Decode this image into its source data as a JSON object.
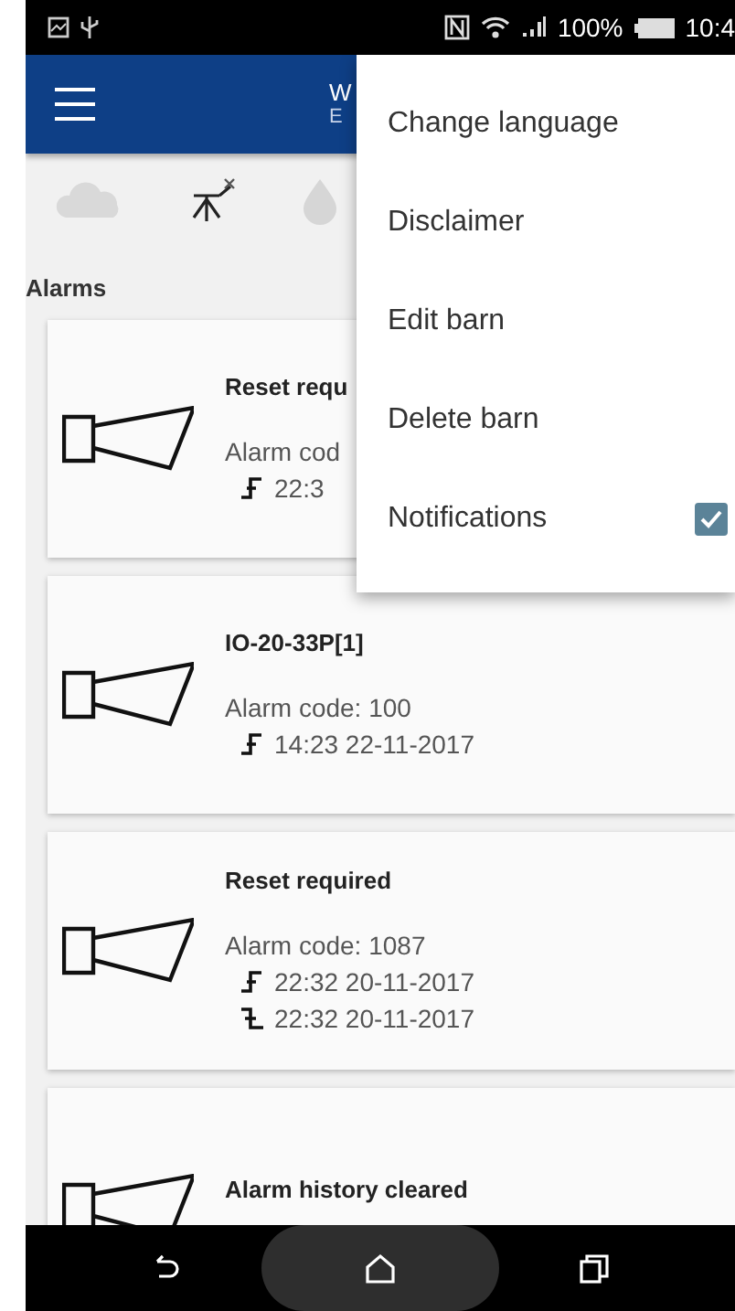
{
  "status_bar": {
    "battery": "100%",
    "time": "10:4"
  },
  "app_bar": {
    "title": "W",
    "subtitle": "E"
  },
  "section_title": "Alarms",
  "alarms": [
    {
      "title": "Reset requ",
      "code": "Alarm cod",
      "events": [
        {
          "kind": "rise",
          "time": "22:3"
        }
      ]
    },
    {
      "title": "IO-20-33P[1]",
      "code": "Alarm code: 100",
      "events": [
        {
          "kind": "rise",
          "time": "14:23 22-11-2017"
        }
      ]
    },
    {
      "title": "Reset required",
      "code": "Alarm code: 1087",
      "events": [
        {
          "kind": "rise",
          "time": "22:32 20-11-2017"
        },
        {
          "kind": "fall",
          "time": "22:32 20-11-2017"
        }
      ]
    },
    {
      "title": "Alarm history cleared"
    }
  ],
  "menu": {
    "items": [
      {
        "kind": "action",
        "label": "Change language"
      },
      {
        "kind": "action",
        "label": "Disclaimer"
      },
      {
        "kind": "action",
        "label": "Edit barn"
      },
      {
        "kind": "action",
        "label": "Delete barn"
      },
      {
        "kind": "toggle",
        "label": "Notifications",
        "checked": true
      }
    ]
  }
}
